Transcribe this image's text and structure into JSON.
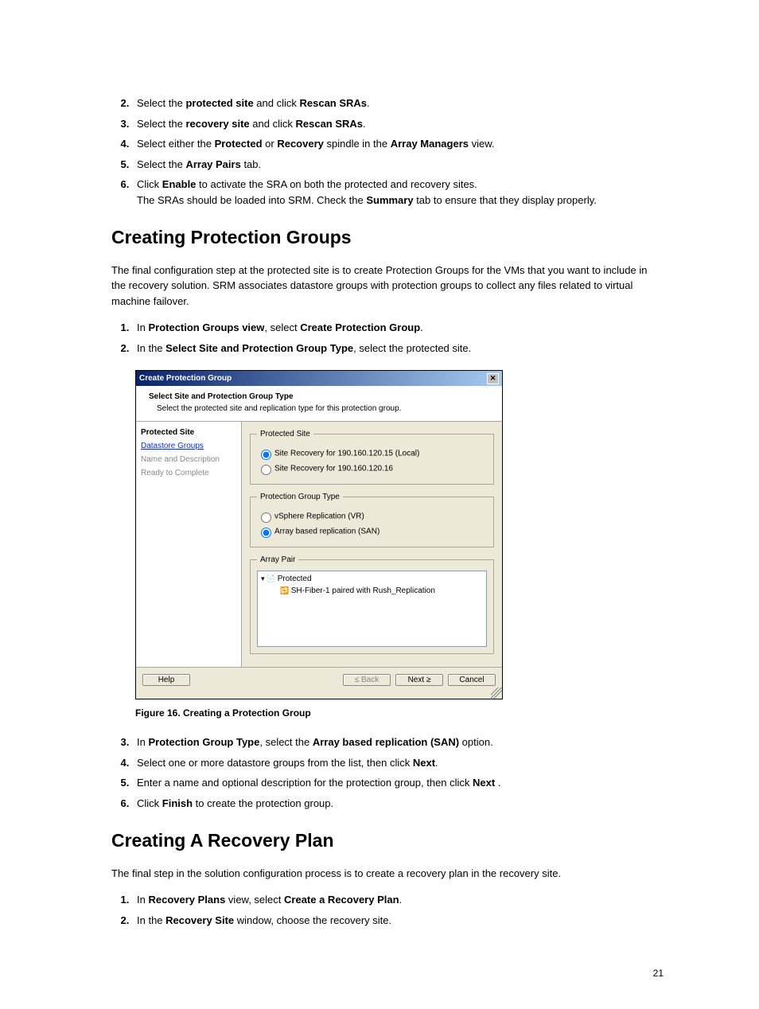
{
  "steps_top": [
    {
      "n": "2.",
      "pre": "Select the ",
      "b1": "protected site",
      "mid": " and click ",
      "b2": "Rescan SRAs",
      "post": "."
    },
    {
      "n": "3.",
      "pre": "Select the ",
      "b1": "recovery site",
      "mid": " and click ",
      "b2": "Rescan SRAs",
      "post": "."
    },
    {
      "n": "4.",
      "pre": "Select either the ",
      "b1": "Protected",
      "mid": " or ",
      "b2": "Recovery",
      "post_pre": " spindle in the ",
      "b3": "Array Managers",
      "post": " view."
    },
    {
      "n": "5.",
      "pre": "Select the ",
      "b1": "Array Pairs",
      "post": " tab."
    },
    {
      "n": "6.",
      "pre": "Click ",
      "b1": "Enable",
      "post": " to activate the SRA on both the protected and recovery sites.",
      "line2_pre": "The SRAs should be loaded into SRM. Check the ",
      "line2_b": "Summary",
      "line2_post": " tab to ensure that they display properly."
    }
  ],
  "h_protection": "Creating Protection Groups",
  "p_protection": "The final configuration step at the protected site is to create Protection Groups for the VMs that you want to include in the recovery solution. SRM associates datastore groups with protection groups to collect any files related to virtual machine failover.",
  "steps_prot1": [
    {
      "n": "1.",
      "pre": "In ",
      "b1": "Protection Groups view",
      "mid": ", select ",
      "b2": "Create Protection Group",
      "post": "."
    },
    {
      "n": "2.",
      "pre": "In the ",
      "b1": "Select Site and Protection Group Type",
      "post": ", select the protected site."
    }
  ],
  "dialog": {
    "title": "Create Protection Group",
    "header_title": "Select Site and Protection Group Type",
    "header_sub": "Select the protected site and replication type for this protection group.",
    "nav": [
      "Protected Site",
      "Datastore Groups",
      "Name and Description",
      "Ready to Complete"
    ],
    "fs_site": "Protected Site",
    "radio_site1": "Site Recovery for 190.160.120.15 (Local)",
    "radio_site2": "Site Recovery for 190.160.120.16",
    "fs_type": "Protection Group Type",
    "radio_type1": "vSphere Replication (VR)",
    "radio_type2": "Array based replication (SAN)",
    "fs_pair": "Array Pair",
    "pair_row1": "Protected",
    "pair_row2": "SH-Fiber-1 paired with Rush_Replication",
    "btn_help": "Help",
    "btn_back": "≤ Back",
    "btn_next": "Next ≥",
    "btn_cancel": "Cancel"
  },
  "figcap": "Figure 16. Creating a Protection Group",
  "steps_prot2": [
    {
      "n": "3.",
      "pre": "In ",
      "b1": "Protection Group Type",
      "mid": ", select the ",
      "b2": "Array based replication (SAN)",
      "post": " option."
    },
    {
      "n": "4.",
      "pre": "Select one or more datastore groups from the list, then click ",
      "b1": "Next",
      "post": "."
    },
    {
      "n": "5.",
      "pre": "Enter a name and optional description for the protection group, then click ",
      "b1": "Next",
      "post": " ."
    },
    {
      "n": "6.",
      "pre": "Click ",
      "b1": "Finish",
      "post": " to create the protection group."
    }
  ],
  "h_recovery": "Creating A Recovery Plan",
  "p_recovery": "The final step in the solution configuration process is to create a recovery plan in the recovery site.",
  "steps_rec": [
    {
      "n": "1.",
      "pre": "In ",
      "b1": "Recovery Plans",
      "mid": " view, select ",
      "b2": "Create a Recovery Plan",
      "post": "."
    },
    {
      "n": "2.",
      "pre": "In the ",
      "b1": "Recovery Site",
      "post": " window, choose the recovery site."
    }
  ],
  "pagenum": "21"
}
